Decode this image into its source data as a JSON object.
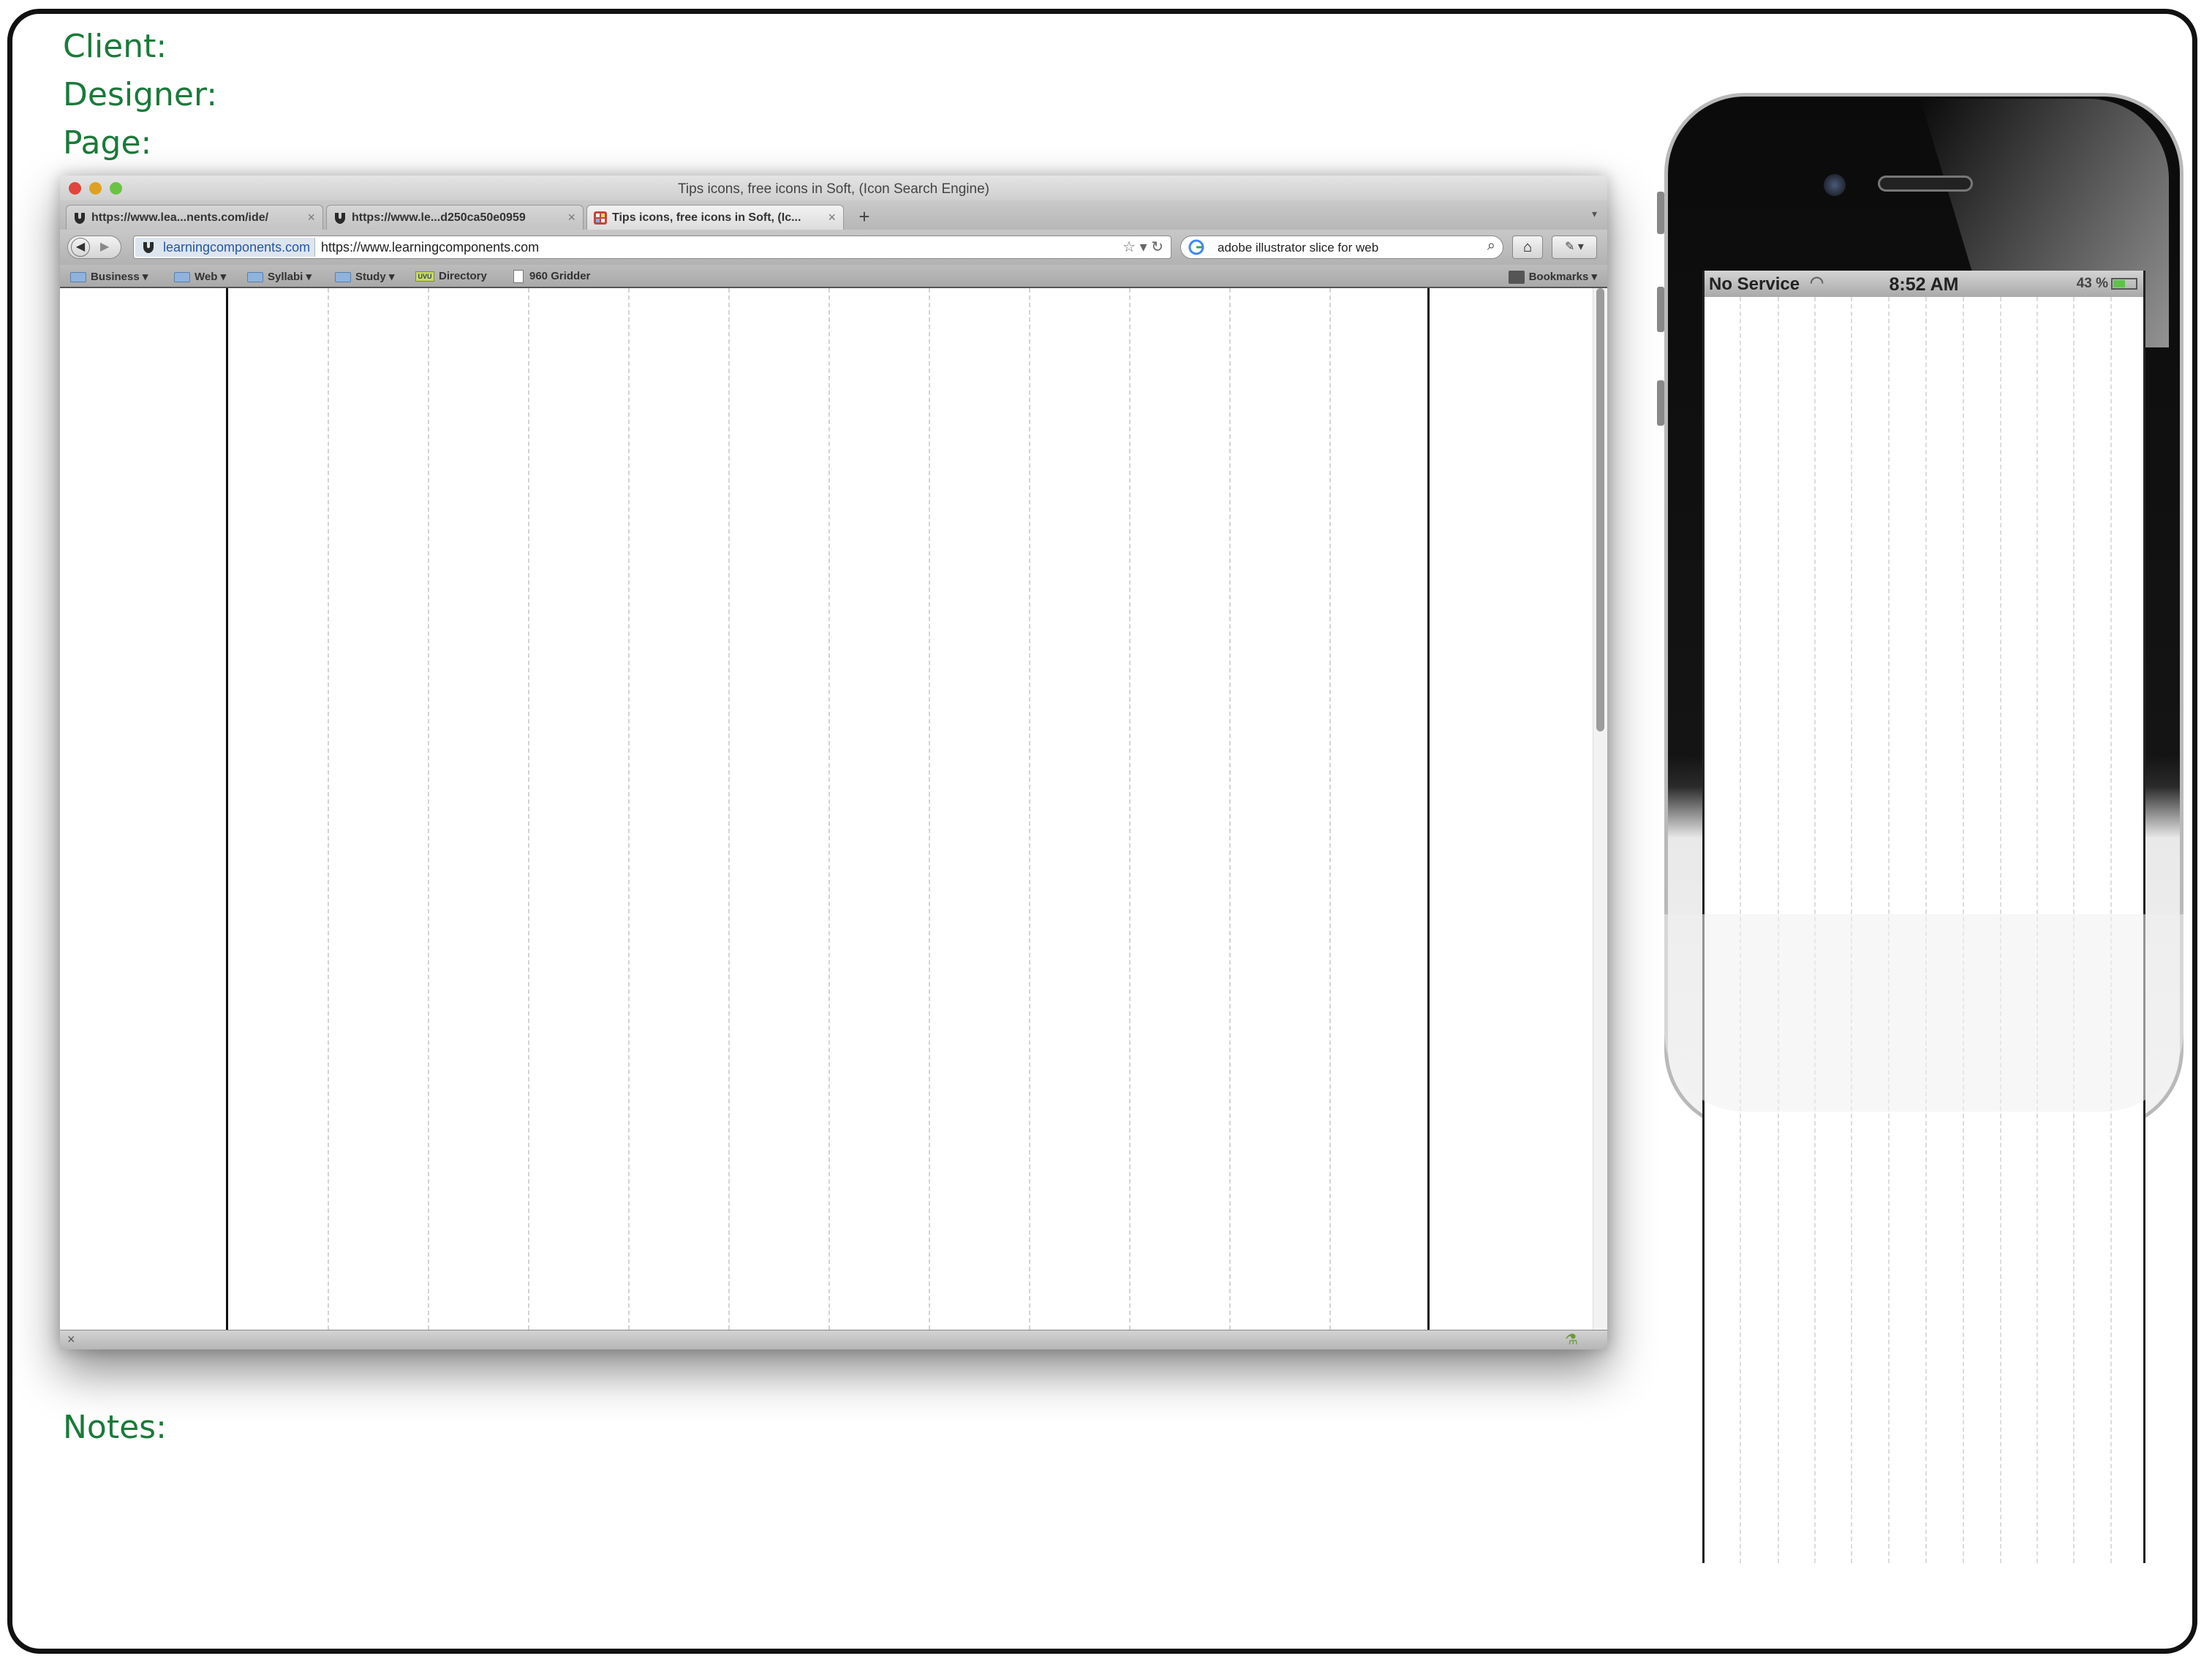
{
  "labels": {
    "client": "Client:",
    "designer": "Designer:",
    "page": "Page:",
    "notes": "Notes:"
  },
  "browser": {
    "window_title": "Tips icons, free icons in Soft, (Icon Search Engine)",
    "tabs": [
      {
        "label": "https://www.lea...nents.com/ide/",
        "active": false
      },
      {
        "label": "https://www.le...d250ca50e0959",
        "active": false
      },
      {
        "label": "Tips icons, free icons in Soft, (Ic...",
        "active": true
      }
    ],
    "new_tab_label": "+",
    "url_site": "learningcomponents.com",
    "url_text": "https://www.learningcomponents.com",
    "search_text": "adobe illustrator slice for web",
    "bookmarks": [
      {
        "label": "Business",
        "icon": "folder-icon"
      },
      {
        "label": "Web",
        "icon": "folder-icon"
      },
      {
        "label": "Syllabi",
        "icon": "folder-icon"
      },
      {
        "label": "Study",
        "icon": "folder-icon"
      },
      {
        "label": "Directory",
        "icon": "uvu-icon",
        "badge": "UVU"
      },
      {
        "label": "960 Gridder",
        "icon": "page-icon"
      }
    ],
    "bookmarks_menu": "Bookmarks"
  },
  "phone": {
    "carrier": "No Service",
    "time": "8:52 AM",
    "battery": "43 %"
  },
  "colors": {
    "label_green": "#1a7a3a",
    "frame": "#111111",
    "grid_dash": "#d3d3d3"
  }
}
